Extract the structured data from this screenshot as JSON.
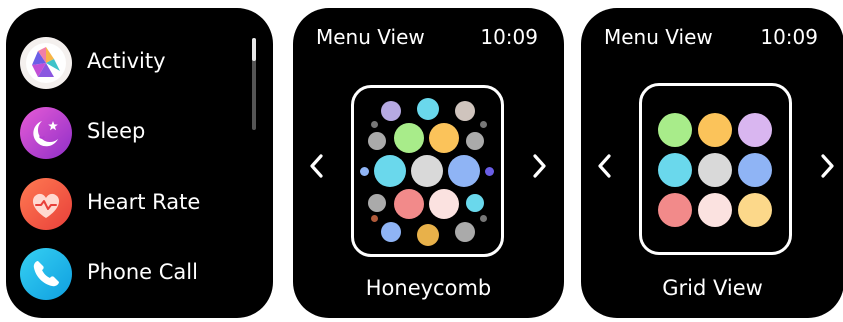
{
  "app_list": {
    "items": [
      {
        "label": "Activity",
        "icon": "activity-icon"
      },
      {
        "label": "Sleep",
        "icon": "sleep-icon"
      },
      {
        "label": "Heart Rate",
        "icon": "heart-rate-icon"
      },
      {
        "label": "Phone Call",
        "icon": "phone-call-icon"
      }
    ],
    "scroll_position": 0.25
  },
  "honeycomb_screen": {
    "title": "Menu View",
    "time": "10:09",
    "caption": "Honeycomb"
  },
  "grid_screen": {
    "title": "Menu View",
    "time": "10:09",
    "caption": "Grid View"
  },
  "colors": {
    "background": "#000000",
    "text": "#ffffff",
    "activity": "#9b59d8",
    "sleep": "#b43cd0",
    "heart_rate": "#f05a3a",
    "phone_call": "#1ab7e8",
    "dot_green": "#a8ec8a",
    "dot_orange": "#fbc35a",
    "dot_lavender": "#d9b6f0",
    "dot_cyan": "#6ad8ec",
    "dot_gray": "#d9d9d9",
    "dot_blue": "#8fb4f5",
    "dot_red": "#f28a8a",
    "dot_pink": "#fbe2e0",
    "dot_yellow": "#fcd88a"
  }
}
